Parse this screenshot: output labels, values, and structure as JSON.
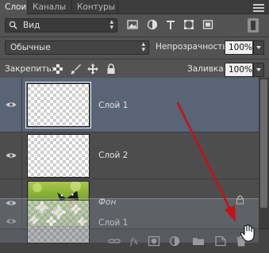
{
  "tabs": [
    {
      "label": "Слои",
      "active": true
    },
    {
      "label": "Каналы",
      "active": false
    },
    {
      "label": "Контуры",
      "active": false
    }
  ],
  "filter": {
    "label": "Вид"
  },
  "filter_icons": [
    "image-filter-icon",
    "adjustment-filter-icon",
    "type-filter-icon",
    "shape-filter-icon",
    "smart-object-filter-icon"
  ],
  "blend": {
    "label": "Обычные"
  },
  "opacity": {
    "label": "Непрозрачность:",
    "value": "100%"
  },
  "lock": {
    "label": "Закрепить:"
  },
  "fill": {
    "label": "Заливка:",
    "value": "100%"
  },
  "layers": [
    {
      "name": "Слой 1",
      "selected": true,
      "visible": true
    },
    {
      "name": "Слой 2",
      "selected": false,
      "visible": true
    },
    {
      "name": "Фон",
      "selected": false,
      "visible": true,
      "locked": true
    }
  ],
  "drag_ghost": {
    "name": "Слой 1"
  },
  "toolbar_icons": [
    "link-layers-icon",
    "fx-icon",
    "add-mask-icon",
    "adjustment-layer-icon",
    "group-folder-icon",
    "new-layer-icon",
    "trash-icon"
  ],
  "colors": {
    "selected_row": "#596477",
    "arrow": "#c0141a",
    "panel_bg": "#535353"
  }
}
